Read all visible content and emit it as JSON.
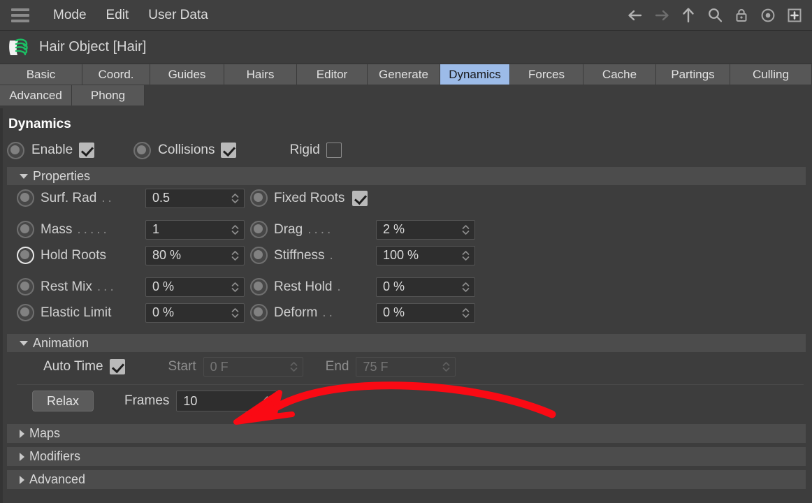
{
  "menubar": {
    "hamburger_name": "hamburger-icon",
    "items": [
      {
        "label": "Mode"
      },
      {
        "label": "Edit"
      },
      {
        "label": "User Data"
      }
    ],
    "icons": [
      {
        "name": "back-arrow-icon"
      },
      {
        "name": "forward-arrow-icon"
      },
      {
        "name": "up-arrow-icon"
      },
      {
        "name": "search-icon"
      },
      {
        "name": "lock-icon"
      },
      {
        "name": "record-icon"
      },
      {
        "name": "add-box-icon"
      }
    ]
  },
  "object": {
    "icon_name": "hair-object-icon",
    "title": "Hair Object [Hair]"
  },
  "tabs": {
    "row1": [
      {
        "label": "Basic",
        "active": false
      },
      {
        "label": "Coord.",
        "active": false
      },
      {
        "label": "Guides",
        "active": false
      },
      {
        "label": "Hairs",
        "active": false
      },
      {
        "label": "Editor",
        "active": false
      },
      {
        "label": "Generate",
        "active": false
      },
      {
        "label": "Dynamics",
        "active": true
      },
      {
        "label": "Forces",
        "active": false
      },
      {
        "label": "Cache",
        "active": false
      },
      {
        "label": "Partings",
        "active": false
      },
      {
        "label": "Culling",
        "active": false
      }
    ],
    "row2": [
      {
        "label": "Advanced",
        "active": false
      },
      {
        "label": "Phong",
        "active": false
      }
    ],
    "active_tab": "Dynamics",
    "active_color": "#9cbbe8"
  },
  "dynamics": {
    "heading": "Dynamics",
    "toggles": [
      {
        "label": "Enable",
        "checked": true,
        "has_track": true
      },
      {
        "label": "Collisions",
        "checked": true,
        "has_track": true
      },
      {
        "label": "Rigid",
        "checked": false,
        "has_track": false
      }
    ]
  },
  "properties": {
    "header": "Properties",
    "expanded": true,
    "rows": [
      {
        "left": {
          "label": "Surf. Rad",
          "dots": "..",
          "value": "0.5",
          "type": "number",
          "highlight": false
        },
        "right": {
          "label": "Fixed Roots",
          "dots": "",
          "checked": true,
          "type": "checkbox"
        }
      },
      {
        "left": {
          "label": "Mass",
          "dots": ".....",
          "value": "1",
          "type": "number",
          "highlight": false
        },
        "right": {
          "label": "Drag",
          "dots": "....",
          "value": "2 %",
          "type": "number"
        }
      },
      {
        "left": {
          "label": "Hold Roots",
          "dots": "",
          "value": "80 %",
          "type": "number",
          "highlight": true
        },
        "right": {
          "label": "Stiffness",
          "dots": ".",
          "value": "100 %",
          "type": "number"
        }
      },
      {
        "left": {
          "label": "Rest Mix",
          "dots": "...",
          "value": "0 %",
          "type": "number",
          "highlight": false
        },
        "right": {
          "label": "Rest Hold",
          "dots": ".",
          "value": "0 %",
          "type": "number"
        }
      },
      {
        "left": {
          "label": "Elastic Limit",
          "dots": "",
          "value": "0 %",
          "type": "number",
          "highlight": false
        },
        "right": {
          "label": "Deform",
          "dots": "..",
          "value": "0 %",
          "type": "number"
        }
      }
    ]
  },
  "animation": {
    "header": "Animation",
    "expanded": true,
    "auto_time": {
      "label": "Auto Time",
      "checked": true
    },
    "start": {
      "label": "Start",
      "value": "0 F",
      "disabled": true
    },
    "end": {
      "label": "End",
      "value": "75 F",
      "disabled": true
    },
    "relax_button": "Relax",
    "frames": {
      "label": "Frames",
      "value": "10",
      "disabled": false
    }
  },
  "collapsed_sections": [
    {
      "header": "Maps",
      "expanded": false
    },
    {
      "header": "Modifiers",
      "expanded": false
    },
    {
      "header": "Advanced",
      "expanded": false
    }
  ],
  "annotation": {
    "name": "red-arrow-annotation",
    "color": "#fa0a14",
    "points_at": "frames-field"
  }
}
